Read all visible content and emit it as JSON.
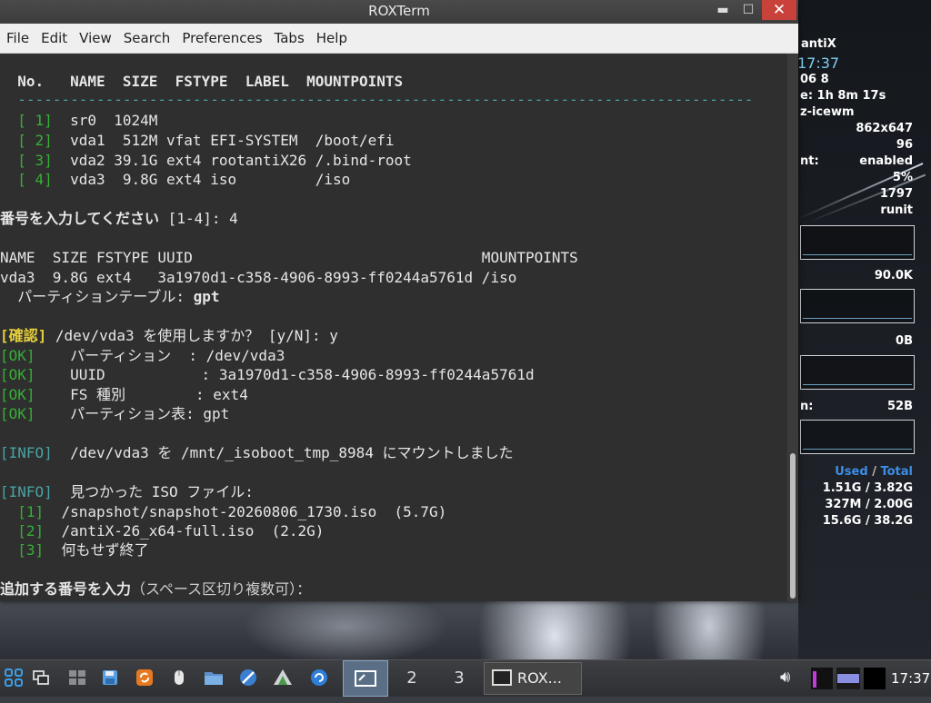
{
  "window": {
    "title": "ROXTerm",
    "minimize": "▬",
    "maximize": "☐",
    "close": "✕"
  },
  "menu": [
    "File",
    "Edit",
    "View",
    "Search",
    "Preferences",
    "Tabs",
    "Help"
  ],
  "terminal": {
    "header": "  No.   NAME  SIZE  FSTYPE  LABEL  MOUNTPOINTS",
    "divider": "  ------------------------------------------------------------------------------------",
    "rows": [
      {
        "num": "  [ 1]",
        "text": "  sr0  1024M"
      },
      {
        "num": "  [ 2]",
        "text": "  vda1  512M vfat EFI-SYSTEM  /boot/efi"
      },
      {
        "num": "  [ 3]",
        "text": "  vda2 39.1G ext4 rootantiX26 /.bind-root"
      },
      {
        "num": "  [ 4]",
        "text": "  vda3  9.8G ext4 iso         /iso"
      }
    ],
    "prompt1_label": "番号を入力してください",
    "prompt1_rest": " [1-4]: 4",
    "table2_header": "NAME  SIZE FSTYPE UUID                                 MOUNTPOINTS",
    "table2_row": "vda3  9.8G ext4   3a1970d1-c358-4906-8993-ff0244a5761d /iso",
    "parttable_label": "  パーティションテーブル: ",
    "parttable_value": "gpt",
    "confirm_tag": "[確認]",
    "confirm_text": " /dev/vda3 を使用しますか？ [y/N]: y",
    "ok_lines": [
      {
        "tag": "[OK]",
        "text": "    パーティション  : /dev/vda3"
      },
      {
        "tag": "[OK]",
        "text": "    UUID           : 3a1970d1-c358-4906-8993-ff0244a5761d"
      },
      {
        "tag": "[OK]",
        "text": "    FS 種別        : ext4"
      },
      {
        "tag": "[OK]",
        "text": "    パーティション表: gpt"
      }
    ],
    "info1_tag": "[INFO]",
    "info1_text": "  /dev/vda3 を /mnt/_isoboot_tmp_8984 にマウントしました",
    "info2_tag": "[INFO]",
    "info2_text": "  見つかった ISO ファイル:",
    "iso_items": [
      {
        "num": "  [1]",
        "text": "  /snapshot/snapshot-20260806_1730.iso  (5.7G)"
      },
      {
        "num": "  [2]",
        "text": "  /antiX-26_x64-full.iso  (2.2G)"
      },
      {
        "num": "  [3]",
        "text": "  何もせず終了"
      }
    ],
    "prompt2": "追加する番号を入力",
    "prompt2_rest": "（スペース区切り複数可）："
  },
  "conky": {
    "host": "antiX",
    "time": "17:37",
    "date": "06  8",
    "uptime": "e: 1h 8m 17s",
    "wm": "z-icewm",
    "resolution": "862x647",
    "val1": "96",
    "compositor_label": "nt:",
    "compositor_value": "enabled",
    "cpu": "5%",
    "processes": "1797",
    "init": "runit",
    "net1": "90.0K",
    "net2": "0B",
    "net3_label": "n:",
    "net3": "52B",
    "mem_header_used": "Used",
    "mem_header_sep": " / ",
    "mem_header_total": "Total",
    "mem": [
      "1.51G / 3.82G",
      "327M / 2.00G",
      "15.6G / 38.2G"
    ]
  },
  "taskbar": {
    "workspaces": [
      "2",
      "3"
    ],
    "task_label": "ROX...",
    "clock": "17:37",
    "icons": [
      "apps-grid-icon",
      "windows-icon",
      "desktop-icon",
      "save-icon",
      "refresh-icon",
      "mouse-icon",
      "folder-icon",
      "no-entry-icon",
      "triangle-app-icon",
      "update-icon"
    ]
  },
  "colors": {
    "ok": "#35b035",
    "confirm": "#e6cf3c",
    "bracket_num": "#3a9bd8",
    "info": "#4aa3a3",
    "close_button": "#c8413a"
  }
}
